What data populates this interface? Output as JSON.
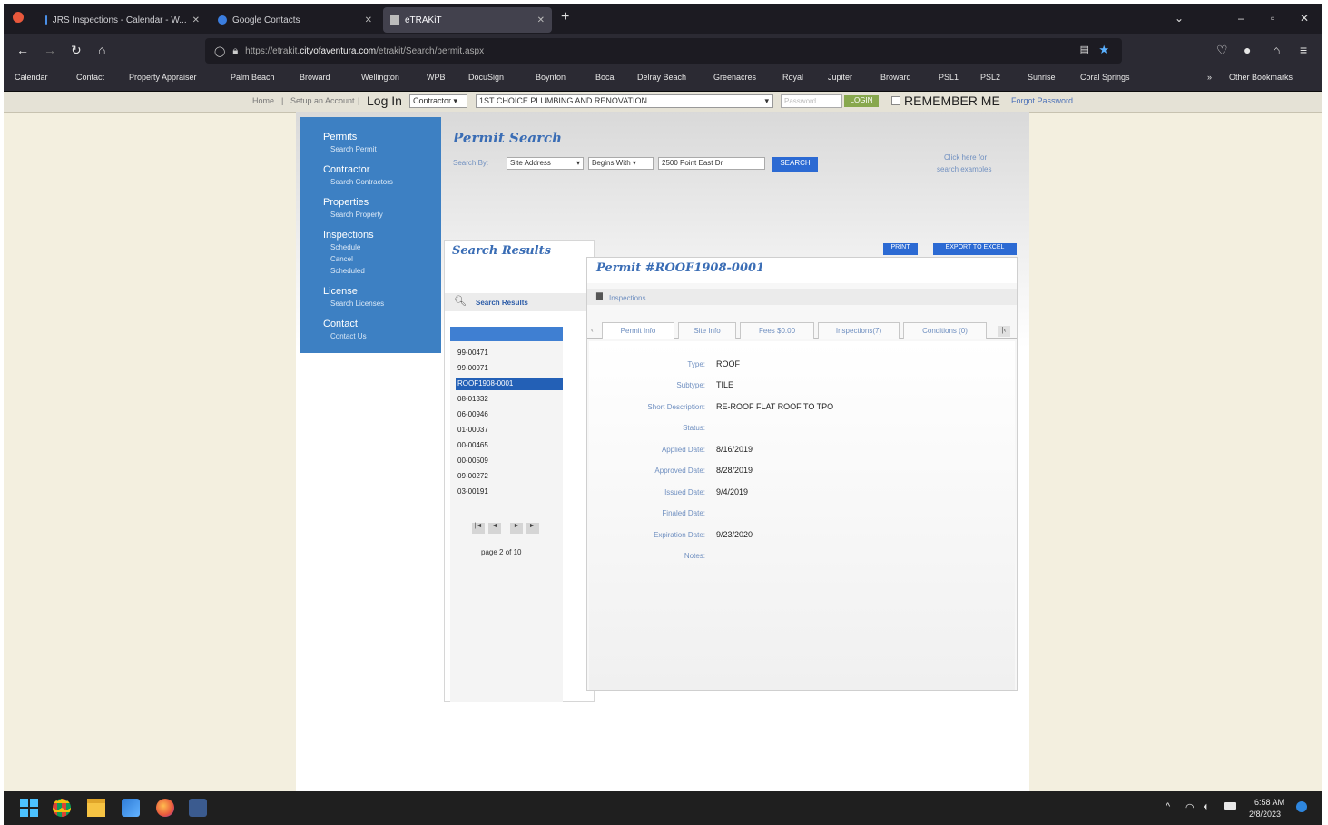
{
  "browser": {
    "tabs": [
      {
        "label": "JRS Inspections - Calendar - W...",
        "icon": "calendar-icon"
      },
      {
        "label": "Google Contacts",
        "icon": "contacts-icon"
      },
      {
        "label": "eTRAKiT",
        "icon": "page-icon"
      }
    ],
    "new_tab": "+",
    "url_prefix": "https://etrakit.",
    "url_domain": "cityofaventura.com",
    "url_path": "/etrakit/Search/permit.aspx",
    "bookmarks": [
      "Calendar",
      "Contact",
      "Property Appraiser",
      "Palm Beach",
      "Broward",
      "Wellington",
      "WPB",
      "DocuSign",
      "Boynton",
      "Boca",
      "Delray Beach",
      "Greenacres",
      "Royal",
      "Jupiter",
      "Broward",
      "PSL1",
      "PSL2",
      "Sunrise",
      "Coral Springs"
    ],
    "other_bookmarks": "Other Bookmarks"
  },
  "login_bar": {
    "home": "Home",
    "setup": "Setup an Account",
    "log_in": "Log In",
    "role": "Contractor",
    "contractor": "1ST CHOICE PLUMBING AND RENOVATION",
    "password_placeholder": "Password",
    "login_button": "LOGIN",
    "remember": "REMEMBER ME",
    "forgot": "Forgot Password"
  },
  "sidenav": {
    "sections": [
      {
        "title": "Permits",
        "items": [
          "Search Permit"
        ]
      },
      {
        "title": "Contractor",
        "items": [
          "Search Contractors"
        ]
      },
      {
        "title": "Properties",
        "items": [
          "Search Property"
        ]
      },
      {
        "title": "Inspections",
        "items": [
          "Schedule",
          "Cancel",
          "Scheduled"
        ]
      },
      {
        "title": "License",
        "items": [
          "Search Licenses"
        ]
      },
      {
        "title": "Contact",
        "items": [
          "Contact Us"
        ]
      }
    ]
  },
  "search": {
    "title": "Permit Search",
    "search_by_label": "Search By:",
    "field": "Site Address",
    "operator": "Begins With",
    "value": "2500 Point East Dr",
    "button": "SEARCH",
    "help": [
      "Click here for",
      "search examples"
    ]
  },
  "results": {
    "title": "Search Results",
    "subheader": "Search Results",
    "items": [
      "99-00471",
      "99-00971",
      "ROOF1908-0001",
      "08-01332",
      "06-00946",
      "01-00037",
      "00-00465",
      "00-00509",
      "09-00272",
      "03-00191"
    ],
    "selected": "ROOF1908-0001",
    "pager": [
      "|◄",
      "◄",
      "►",
      "►|"
    ],
    "page_label": "page 2 of 10"
  },
  "permit": {
    "print": "PRINT",
    "export": "EXPORT TO EXCEL",
    "title": "Permit #ROOF1908-0001",
    "inspections_link": "Inspections",
    "tabs": [
      "Permit Info",
      "Site Info",
      "Fees $0.00",
      "Inspections(7)",
      "Conditions (0)"
    ],
    "fields": [
      {
        "label": "Type:",
        "value": "ROOF"
      },
      {
        "label": "Subtype:",
        "value": "TILE"
      },
      {
        "label": "Short Description:",
        "value": "RE-ROOF FLAT ROOF TO TPO"
      },
      {
        "label": "Status:",
        "value": ""
      },
      {
        "label": "Applied Date:",
        "value": "8/16/2019"
      },
      {
        "label": "Approved Date:",
        "value": "8/28/2019"
      },
      {
        "label": "Issued Date:",
        "value": "9/4/2019"
      },
      {
        "label": "Finaled Date:",
        "value": ""
      },
      {
        "label": "Expiration Date:",
        "value": "9/23/2020"
      },
      {
        "label": "Notes:",
        "value": ""
      }
    ]
  },
  "taskbar": {
    "time": "6:58 AM",
    "date": "2/8/2023",
    "up_arrow": "^"
  },
  "colors": {
    "nav_blue": "#3d80c3",
    "accent_blue": "#2c6ad3",
    "page_bg": "#f3efdf"
  }
}
